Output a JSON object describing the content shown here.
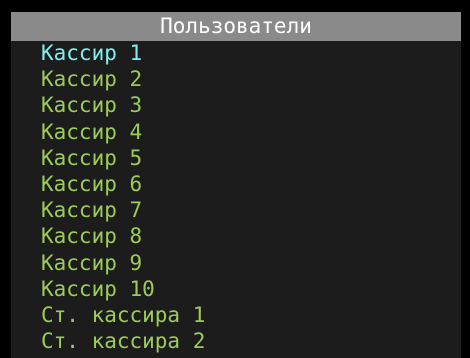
{
  "title": "Пользователи",
  "colors": {
    "selected": "#7ff0f0",
    "normal": "#9ccc5a",
    "title_bar": "#8a8a8a",
    "panel": "#1c1c1c"
  },
  "selected_index": 0,
  "items": [
    {
      "label": "Кассир 1"
    },
    {
      "label": "Кассир 2"
    },
    {
      "label": "Кассир 3"
    },
    {
      "label": "Кассир 4"
    },
    {
      "label": "Кассир 5"
    },
    {
      "label": "Кассир 6"
    },
    {
      "label": "Кассир 7"
    },
    {
      "label": "Кассир 8"
    },
    {
      "label": "Кассир 9"
    },
    {
      "label": "Кассир 10"
    },
    {
      "label": "Ст. кассира 1"
    },
    {
      "label": "Ст. кассира 2"
    }
  ]
}
